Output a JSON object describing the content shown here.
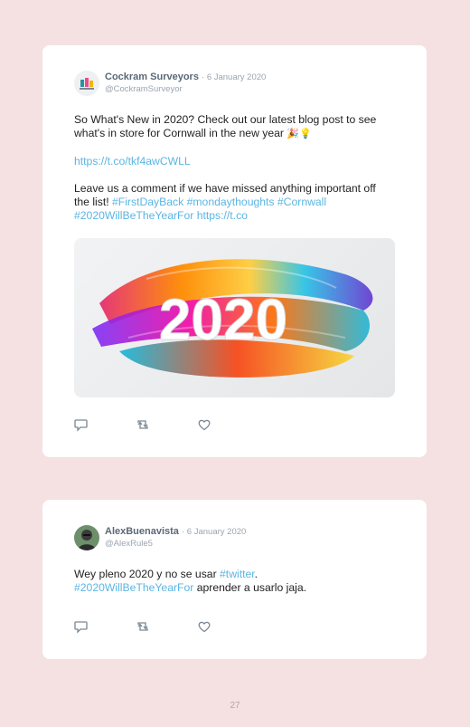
{
  "tweets": [
    {
      "author": "Cockram Surveyors",
      "date": "· 6 January 2020",
      "handle": "@CockramSurveyor",
      "text": {
        "p1": "So What's New in 2020? Check out our latest blog post to see what's in store for Cornwall in the new year ",
        "emoji": "🎉💡",
        "link": "https://t.co/tkf4awCWLL",
        "p3_plain": "Leave us a comment if we have missed anything important off the list! ",
        "hashtags": "#FirstDayBack #mondaythoughts #Cornwall #2020WillBeTheYearFor https://t.co"
      },
      "media": {
        "text": "2020"
      },
      "actions": [
        "reply-icon",
        "retweet-icon",
        "heart-icon"
      ]
    },
    {
      "author": "AlexBuenavista",
      "date": "· 6 January 2020",
      "handle": "@AlexRule5",
      "text": {
        "a": "Wey pleno 2020 y no se usar ",
        "tag1": "#twitter",
        "b": ".",
        "tag2": "#2020WillBeTheYearFor",
        "c": " aprender a usarlo jaja."
      },
      "actions": [
        "reply-icon",
        "retweet-icon",
        "heart-icon"
      ]
    }
  ],
  "page_number": "27",
  "colors": {
    "background": "#f5e1e2",
    "card": "#ffffff",
    "link": "#5bb5e2",
    "name": "#5b6876",
    "meta": "#9aa5b1"
  }
}
